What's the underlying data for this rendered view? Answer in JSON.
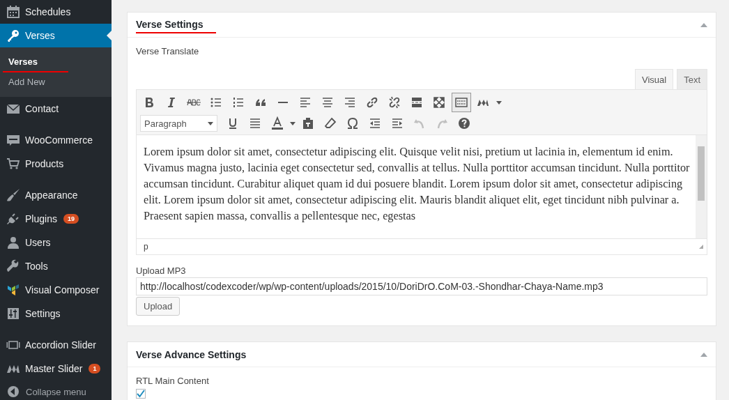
{
  "sidebar": {
    "groups": [
      [
        {
          "label": "Schedules",
          "kind": "calendar",
          "selected": false
        },
        {
          "label": "Verses",
          "kind": "key",
          "selected": true,
          "submenu": [
            {
              "label": "Verses",
              "selected": true,
              "underlined": true
            },
            {
              "label": "Add New",
              "selected": false,
              "underlined": false
            }
          ]
        },
        {
          "label": "Contact",
          "kind": "envelope",
          "selected": false
        }
      ],
      [
        {
          "label": "WooCommerce",
          "kind": "bubble",
          "selected": false
        },
        {
          "label": "Products",
          "kind": "cart",
          "selected": false
        }
      ],
      [
        {
          "label": "Appearance",
          "kind": "brush",
          "selected": false
        },
        {
          "label": "Plugins",
          "kind": "plug",
          "selected": false,
          "badge": "19"
        },
        {
          "label": "Users",
          "kind": "person",
          "selected": false
        },
        {
          "label": "Tools",
          "kind": "wrench",
          "selected": false
        },
        {
          "label": "Visual Composer",
          "kind": "blocks",
          "selected": false
        },
        {
          "label": "Settings",
          "kind": "sliders",
          "selected": false
        }
      ],
      [
        {
          "label": "Accordion Slider",
          "kind": "frames",
          "selected": false
        },
        {
          "label": "Master Slider",
          "kind": "zigzag",
          "selected": false,
          "badge": "1"
        }
      ]
    ],
    "collapse": "Collapse menu"
  },
  "boxes": [
    {
      "title": "Verse Settings",
      "underlined": true,
      "kind": "settings",
      "field_label": "Verse Translate",
      "editor": {
        "tabs": [
          {
            "label": "Visual",
            "selected": true
          },
          {
            "label": "Text",
            "selected": false
          }
        ],
        "toolbar": [
          [
            {
              "kind": "bold",
              "active": false,
              "disabled": false
            },
            {
              "kind": "italic",
              "active": false,
              "disabled": false
            },
            {
              "kind": "strike",
              "active": false,
              "disabled": false
            },
            {
              "kind": "bullets",
              "active": false,
              "disabled": false
            },
            {
              "kind": "numbers",
              "active": false,
              "disabled": false
            },
            {
              "kind": "quote",
              "active": false,
              "disabled": false
            },
            {
              "kind": "rule",
              "active": false,
              "disabled": false
            },
            {
              "kind": "align-left",
              "active": false,
              "disabled": false
            },
            {
              "kind": "align-center",
              "active": false,
              "disabled": false
            },
            {
              "kind": "align-right",
              "active": false,
              "disabled": false
            },
            {
              "kind": "link",
              "active": false,
              "disabled": false
            },
            {
              "kind": "unlink",
              "active": false,
              "disabled": false
            },
            {
              "kind": "more",
              "active": false,
              "disabled": false
            },
            {
              "kind": "fullscreen",
              "active": false,
              "disabled": false
            },
            {
              "kind": "toolbar-toggle",
              "active": true,
              "disabled": false
            },
            {
              "kind": "zigzag-menu",
              "active": false,
              "disabled": false
            }
          ],
          [
            {
              "kind": "select",
              "value": "Paragraph"
            },
            {
              "kind": "underline",
              "active": false,
              "disabled": false
            },
            {
              "kind": "justify",
              "active": false,
              "disabled": false
            },
            {
              "kind": "text-color",
              "active": false,
              "disabled": false
            },
            {
              "kind": "paste",
              "active": false,
              "disabled": false
            },
            {
              "kind": "eraser",
              "active": false,
              "disabled": false
            },
            {
              "kind": "omega",
              "active": false,
              "disabled": false
            },
            {
              "kind": "outdent",
              "active": false,
              "disabled": false
            },
            {
              "kind": "indent",
              "active": false,
              "disabled": false
            },
            {
              "kind": "undo",
              "active": false,
              "disabled": true
            },
            {
              "kind": "redo",
              "active": false,
              "disabled": true
            },
            {
              "kind": "help",
              "active": false,
              "disabled": false
            }
          ]
        ],
        "content": "Lorem ipsum dolor sit amet, consectetur adipiscing elit. Quisque velit nisi, pretium ut lacinia in, elementum id enim. Vivamus magna justo, lacinia eget consectetur sed, convallis at tellus. Nulla porttitor accumsan tincidunt. Nulla porttitor accumsan tincidunt. Curabitur aliquet quam id dui posuere blandit. Lorem ipsum dolor sit amet, consectetur adipiscing elit. Lorem ipsum dolor sit amet, consectetur adipiscing elit. Mauris blandit aliquet elit, eget tincidunt nibh pulvinar a. Praesent sapien massa, convallis a pellentesque nec, egestas",
        "path": "p"
      },
      "upload_label": "Upload MP3",
      "upload_value": "http://localhost/codexcoder/wp/wp-content/uploads/2015/10/DoriDrO.CoM-03.-Shondhar-Chaya-Name.mp3",
      "upload_button": "Upload"
    },
    {
      "title": "Verse Advance Settings",
      "underlined": false,
      "kind": "advanced",
      "checkbox_label": "RTL Main Content",
      "checked": true
    }
  ]
}
